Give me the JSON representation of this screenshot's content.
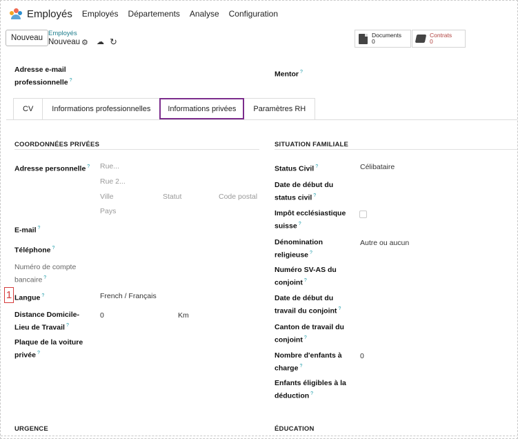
{
  "topnav": {
    "app_name": "Employés",
    "items": [
      "Employés",
      "Départements",
      "Analyse",
      "Configuration"
    ]
  },
  "control": {
    "new_button": "Nouveau",
    "breadcrumb_parent": "Employés",
    "breadcrumb_current": "Nouveau",
    "gear_icon": "gear-icon",
    "cloud_icon": "cloud-upload-icon",
    "undo_icon": "undo-icon",
    "smart_buttons": [
      {
        "label": "Documents",
        "count": "0",
        "icon": "document-icon"
      },
      {
        "label": "Contrats",
        "count": "0",
        "icon": "book-icon"
      }
    ]
  },
  "header_fields": {
    "work_email_label_1": "Adresse e-mail",
    "work_email_label_2": "professionnelle",
    "mentor_label": "Mentor"
  },
  "tabs": [
    "CV",
    "Informations professionnelles",
    "Informations privées",
    "Paramètres RH"
  ],
  "active_tab": "Informations privées",
  "private": {
    "section_title": "COORDONNÉES PRIVÉES",
    "address_label": "Adresse personnelle",
    "street_placeholder": "Rue...",
    "street2_placeholder": "Rue 2...",
    "city_placeholder": "Ville",
    "state_placeholder": "Statut",
    "zip_placeholder": "Code postal",
    "country_placeholder": "Pays",
    "email_label": "E-mail",
    "phone_label": "Téléphone",
    "bank_label_1": "Numéro de compte",
    "bank_label_2": "bancaire",
    "lang_label": "Langue",
    "lang_value": "French / Français",
    "distance_label_1": "Distance Domicile-",
    "distance_label_2": "Lieu de Travail",
    "distance_value": "0",
    "distance_unit": "Km",
    "plate_label_1": "Plaque de la voiture",
    "plate_label_2": "privée"
  },
  "family": {
    "section_title": "SITUATION FAMILIALE",
    "civil_label": "Status Civil",
    "civil_value": "Célibataire",
    "civil_date_label_1": "Date de début du",
    "civil_date_label_2": "status civil",
    "tax_label_1": "Impôt ecclésiastique",
    "tax_label_2": "suisse",
    "religion_label_1": "Dénomination",
    "religion_label_2": "religieuse",
    "religion_value": "Autre ou aucun",
    "avs_label_1": "Numéro SV-AS du",
    "avs_label_2": "conjoint",
    "spouse_work_label_1": "Date de début du",
    "spouse_work_label_2": "travail du conjoint",
    "canton_label_1": "Canton de travail du",
    "canton_label_2": "conjoint",
    "children_label_1": "Nombre d'enfants à",
    "children_label_2": "charge",
    "children_value": "0",
    "eligible_label_1": "Enfants éligibles à la",
    "eligible_label_2": "déduction"
  },
  "bottom_sections": {
    "emergency": "URGENCE",
    "education": "ÉDUCATION"
  },
  "help_mark": "?",
  "annotation_marker": "1"
}
